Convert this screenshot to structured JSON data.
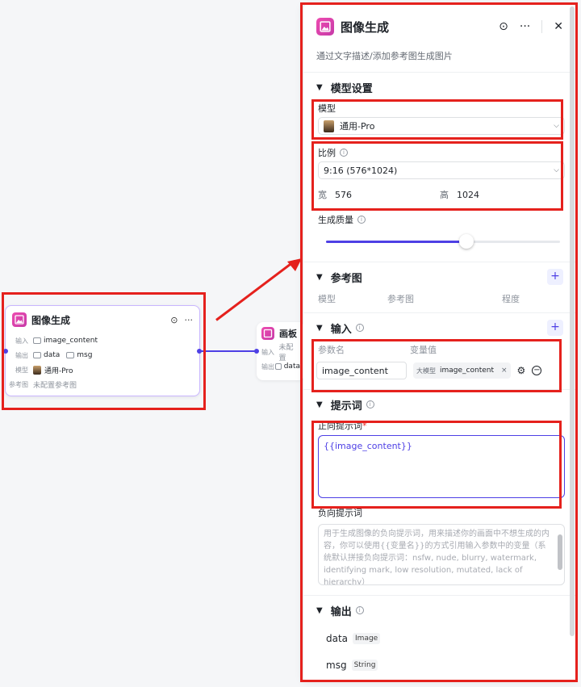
{
  "node_image": {
    "title": "图像生成",
    "input_label": "输入",
    "input_value": "image_content",
    "output_label": "输出",
    "output_value_1": "data",
    "output_value_2": "msg",
    "model_label": "模型",
    "model_value": "通用-Pro",
    "ref_label": "参考图",
    "ref_value": "未配置参考图"
  },
  "node_board": {
    "title": "画板",
    "input_label": "输入",
    "input_value": "未配置",
    "output_label": "输出",
    "output_value": "data"
  },
  "panel": {
    "title": "图像生成",
    "description": "通过文字描述/添加参考图生成图片",
    "model_section": "模型设置",
    "model_label": "模型",
    "model_value": "通用-Pro",
    "ratio_label": "比例",
    "ratio_value": "9:16 (576*1024)",
    "width_label": "宽",
    "width_value": "576",
    "height_label": "高",
    "height_value": "1024",
    "quality_label": "生成质量",
    "quality_level": 0.6,
    "ref_section": "参考图",
    "ref_col_1": "模型",
    "ref_col_2": "参考图",
    "ref_col_3": "程度",
    "input_section": "输入",
    "param_col": "参数名",
    "value_col": "变量值",
    "param_name": "image_content",
    "value_tag": "大模型",
    "value_name": "image_content",
    "prompt_section": "提示词",
    "pos_prompt_label": "正向提示词",
    "pos_prompt_value": "{{image_content}}",
    "neg_prompt_label": "负向提示词",
    "neg_prompt_placeholder": "用于生成图像的负向提示词，用来描述你的画面中不想生成的内容，你可以使用{{变量名}}的方式引用输入参数中的变量（系统默认拼接负向提示词：nsfw, nude, blurry, watermark, identifying mark, low resolution, mutated, lack of hierarchy）",
    "output_section": "输出",
    "outputs": [
      {
        "name": "data",
        "type": "Image"
      },
      {
        "name": "msg",
        "type": "String"
      }
    ]
  },
  "colors": {
    "accent": "#4e40e5",
    "highlight": "#e5211d",
    "icon": "#d63cae"
  }
}
